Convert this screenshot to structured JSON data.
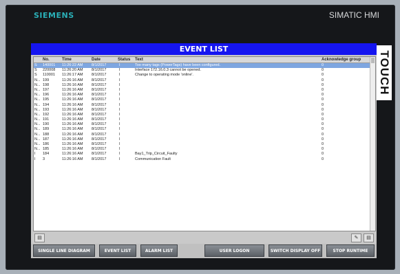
{
  "device": {
    "brand": "SIEMENS",
    "model": "SIMATIC HMI",
    "side_label": "TOUCH"
  },
  "screen": {
    "title": "EVENT LIST",
    "columns": [
      "No.",
      "Time",
      "Date",
      "Status",
      "Text",
      "Acknowledge group"
    ],
    "rows": [
      {
        "mark": "S",
        "no": "140001",
        "time": "11:26:22 AM",
        "date": "8/1/2017",
        "status": "I",
        "text": "Too many tags (PowerTags) have been configured.",
        "ack": "0",
        "selected": true
      },
      {
        "mark": "S",
        "no": "220008",
        "time": "11:26:20 AM",
        "date": "8/1/2017",
        "status": "I",
        "text": "Interface 172.16.0.3 cannot be opened.",
        "ack": "0"
      },
      {
        "mark": "S",
        "no": "110001",
        "time": "11:26:17 AM",
        "date": "8/1/2017",
        "status": "I",
        "text": "Change to operating mode 'online'.",
        "ack": "0"
      },
      {
        "mark": "N...",
        "no": "199",
        "time": "11:26:16 AM",
        "date": "8/1/2017",
        "status": "I",
        "text": "",
        "ack": "0"
      },
      {
        "mark": "N...",
        "no": "198",
        "time": "11:26:16 AM",
        "date": "8/1/2017",
        "status": "I",
        "text": "",
        "ack": "0"
      },
      {
        "mark": "N...",
        "no": "197",
        "time": "11:26:16 AM",
        "date": "8/1/2017",
        "status": "I",
        "text": "",
        "ack": "0"
      },
      {
        "mark": "N...",
        "no": "196",
        "time": "11:26:16 AM",
        "date": "8/1/2017",
        "status": "I",
        "text": "",
        "ack": "0"
      },
      {
        "mark": "N...",
        "no": "195",
        "time": "11:26:16 AM",
        "date": "8/1/2017",
        "status": "I",
        "text": "",
        "ack": "0"
      },
      {
        "mark": "N...",
        "no": "194",
        "time": "11:26:16 AM",
        "date": "8/1/2017",
        "status": "I",
        "text": "",
        "ack": "0"
      },
      {
        "mark": "N...",
        "no": "193",
        "time": "11:26:16 AM",
        "date": "8/1/2017",
        "status": "I",
        "text": "",
        "ack": "0"
      },
      {
        "mark": "N...",
        "no": "192",
        "time": "11:26:16 AM",
        "date": "8/1/2017",
        "status": "I",
        "text": "",
        "ack": "0"
      },
      {
        "mark": "N...",
        "no": "191",
        "time": "11:26:16 AM",
        "date": "8/1/2017",
        "status": "I",
        "text": "",
        "ack": "0"
      },
      {
        "mark": "N...",
        "no": "190",
        "time": "11:26:16 AM",
        "date": "8/1/2017",
        "status": "I",
        "text": "",
        "ack": "0"
      },
      {
        "mark": "N...",
        "no": "189",
        "time": "11:26:16 AM",
        "date": "8/1/2017",
        "status": "I",
        "text": "",
        "ack": "0"
      },
      {
        "mark": "N...",
        "no": "188",
        "time": "11:26:16 AM",
        "date": "8/1/2017",
        "status": "I",
        "text": "",
        "ack": "0"
      },
      {
        "mark": "N...",
        "no": "187",
        "time": "11:26:16 AM",
        "date": "8/1/2017",
        "status": "I",
        "text": "",
        "ack": "0"
      },
      {
        "mark": "N...",
        "no": "186",
        "time": "11:26:16 AM",
        "date": "8/1/2017",
        "status": "I",
        "text": "",
        "ack": "0"
      },
      {
        "mark": "N...",
        "no": "185",
        "time": "11:26:16 AM",
        "date": "8/1/2017",
        "status": "I",
        "text": "",
        "ack": "0"
      },
      {
        "mark": "I",
        "no": "184",
        "time": "11:26:16 AM",
        "date": "8/1/2017",
        "status": "I",
        "text": "Bay1_Trip_Circuit_Faulty",
        "ack": "0"
      },
      {
        "mark": "I",
        "no": "3",
        "time": "11:26:16 AM",
        "date": "8/1/2017",
        "status": "I",
        "text": "Communication Fault",
        "ack": "0"
      }
    ]
  },
  "toolbar_icons": {
    "left": "info-icon",
    "right_1": "edit-icon",
    "right_2": "acknowledge-icon"
  },
  "buttons": [
    "SINGLE LINE DIAGRAM",
    "EVENT LIST",
    "ALARM LIST",
    "USER LOGON",
    "SWITCH DISPLAY OFF",
    "STOP RUNTIME"
  ],
  "colors": {
    "title_bar": "#1515f0",
    "selected_row": "#7ea6e0",
    "brand": "#2ab0b8"
  }
}
